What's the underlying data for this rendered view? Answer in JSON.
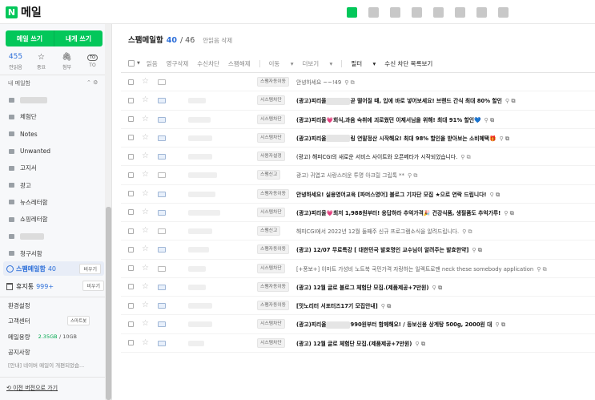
{
  "brand": {
    "logo_letter": "N",
    "title": "메일",
    "accent": "#03c75a"
  },
  "topbar": {
    "apps": [
      "mail-icon",
      "calendar-icon",
      "memo-icon",
      "contacts-icon",
      "mybox-icon",
      "grid-icon",
      "home-icon",
      "bookmark-icon"
    ]
  },
  "sidebar": {
    "compose_label": "메일 쓰기",
    "compose_self_label": "내게 쓰기",
    "quick": {
      "unread_count": "455",
      "unread_label": "안읽음",
      "important_label": "중요",
      "attachment_label": "첨부",
      "to_badge": "TO",
      "to_label": "TO"
    },
    "mybox_label": "내 메일함",
    "mybox_ctrl": "⌃ ⚙",
    "folders": [
      {
        "label": ""
      },
      {
        "label": "체험단"
      },
      {
        "label": "Notes"
      },
      {
        "label": "Unwanted"
      },
      {
        "label": "고지서"
      },
      {
        "label": "광고"
      },
      {
        "label": "뉴스레터함"
      },
      {
        "label": "쇼핑레터함"
      },
      {
        "label": ""
      },
      {
        "label": "청구서함"
      }
    ],
    "spam": {
      "label": "스팸메일함",
      "count": "40",
      "empty_label": "비우기"
    },
    "trash": {
      "label": "휴지통",
      "count": "999+",
      "empty_label": "비우기"
    },
    "settings_label": "환경설정",
    "support_label": "고객센터",
    "smart_btn": "스마트봇",
    "storage_label": "메일용량",
    "storage_used": "2.35GB",
    "storage_total": "/ 10GB",
    "notice_label": "공지사항",
    "notice_text": "[안내] 네이버 메일이 개편되었습...",
    "prev_version": "이전 버전으로 가기"
  },
  "main": {
    "title": "스팸메일함",
    "count": "40",
    "total": "/ 46",
    "unread_delete": "안읽음 삭제",
    "toolbar": {
      "read": "읽음",
      "perm_delete": "영구삭제",
      "block_receive": "수신차단",
      "unspam": "스팸해제",
      "move": "이동",
      "more": "더보기",
      "filter": "필터",
      "block_list": "수신 차단 목록보기"
    },
    "rows": [
      {
        "tag": "스팸자동이동",
        "subject": "안녕하세요 ~~!49",
        "read": true,
        "bold": false,
        "mask": false,
        "sender_w": 0
      },
      {
        "tag": "시스템차단",
        "subject": "(광고)피리올",
        "subject2": "곧 떨어질 때, 입에 바로 넣어보세요! 브랜드 간식 최대 80% 할인",
        "read": false,
        "bold": true,
        "mask": true,
        "sender_w": 22
      },
      {
        "tag": "시스템차단",
        "subject": "(광고)피리올💗회식,과음 숙취에 괴로웠던 이제서님을 위해! 최대 91% 할인💙",
        "read": false,
        "bold": true,
        "mask": false,
        "sender_w": 28
      },
      {
        "tag": "시스템차단",
        "subject": "(광고)피리올",
        "subject2": "링 연말정산 시작해요! 최대 98% 할인을 받아보는 소비혜택🎁",
        "read": false,
        "bold": true,
        "mask": true,
        "sender_w": 30
      },
      {
        "tag": "사용자설정",
        "subject": "(광고) 해피CGI의 새로운 서비스 사이트와 오픈베타가 시작되었습니다.",
        "read": false,
        "bold": false,
        "mask": false,
        "sender_w": 30
      },
      {
        "tag": "스팸신고",
        "subject": "광고) 귀엽고 사랑스러운 투명 아크릴 그립톡 **",
        "read": true,
        "bold": false,
        "mask": false,
        "sender_w": 36
      },
      {
        "tag": "스팸자동이동",
        "subject": "안녕하세요! 실용영어교육 [파머스영어] 블로그 기자단 모집 ★으로 연락 드립니다!",
        "read": false,
        "bold": true,
        "mask": false,
        "sender_w": 34
      },
      {
        "tag": "시스템차단",
        "subject": "(광고)피리올💗최저 1,988원부터! 응답하라 추억가격🎉 건강식품, 생필품도 추억가루!",
        "read": false,
        "bold": true,
        "mask": false,
        "sender_w": 40
      },
      {
        "tag": "스팸신고",
        "subject": "해피CGI에서 2022년 12월 둘째주 신규 프로그램소식을 알려드립니다.",
        "read": true,
        "bold": false,
        "mask": false,
        "sender_w": 30
      },
      {
        "tag": "스팸자동이동",
        "subject": "(광고) 12/07 무료특강 [ 대한민국 발효명인 교수님이 알려주는 발효한약]",
        "read": false,
        "bold": true,
        "mask": false,
        "sender_w": 26
      },
      {
        "tag": "시스템차단",
        "subject": "[+풍보+] 이마트 가성비 노트북 국민가격 자랑하는 일렉트로맨 neck these somebody application",
        "read": true,
        "bold": false,
        "mask": false,
        "sender_w": 22
      },
      {
        "tag": "스팸자동이동",
        "subject": "(광고) 12월 글로 블로그 체험단 모집.(제품제공+7만원)",
        "read": false,
        "bold": true,
        "mask": false,
        "sender_w": 22
      },
      {
        "tag": "스팸자동이동",
        "subject": "[맛노리터 서포터즈17기 모집안내]",
        "read": false,
        "bold": true,
        "mask": false,
        "sender_w": 30
      },
      {
        "tag": "시스템차단",
        "subject": "(광고)피리올",
        "subject2": "990원부터 함께해요! / 등보신용 상계탕 500g, 2000원 대",
        "read": false,
        "bold": true,
        "mask": true,
        "sender_w": 30
      },
      {
        "tag": "시스템차단",
        "subject": "(광고) 12월 글로 체험단 모집.(제품제공+7만원)",
        "read": false,
        "bold": true,
        "mask": false,
        "sender_w": 20
      }
    ]
  }
}
